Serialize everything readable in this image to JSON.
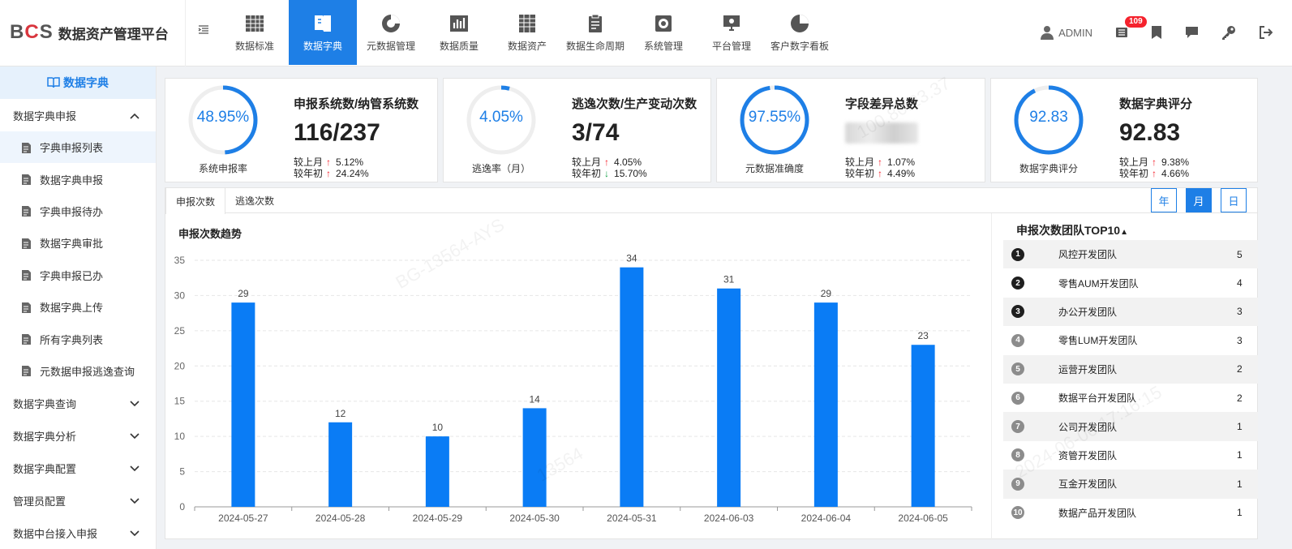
{
  "app": {
    "logo_b": "B",
    "logo_c": "C",
    "logo_s": "S",
    "name": "数据资产管理平台"
  },
  "nav": [
    {
      "label": "数据标准",
      "icon": "table-grid-icon",
      "active": false
    },
    {
      "label": "数据字典",
      "icon": "book-icon",
      "active": true
    },
    {
      "label": "元数据管理",
      "icon": "pie-chart-icon",
      "active": false
    },
    {
      "label": "数据质量",
      "icon": "bar-chart-icon",
      "active": false
    },
    {
      "label": "数据资产",
      "icon": "spreadsheet-icon",
      "active": false
    },
    {
      "label": "数据生命周期",
      "icon": "clipboard-icon",
      "active": false
    },
    {
      "label": "系统管理",
      "icon": "gear-icon",
      "active": false
    },
    {
      "label": "平台管理",
      "icon": "monitor-icon",
      "active": false
    },
    {
      "label": "客户数字看板",
      "icon": "dashboard-pie-icon",
      "active": false
    }
  ],
  "user": {
    "name": "ADMIN",
    "notification_count": "109"
  },
  "sidebar": {
    "title": "数据字典",
    "groups": [
      {
        "label": "数据字典申报",
        "expanded": true,
        "items": [
          {
            "label": "字典申报列表",
            "active": true
          },
          {
            "label": "数据字典申报",
            "active": false
          },
          {
            "label": "字典申报待办",
            "active": false
          },
          {
            "label": "数据字典审批",
            "active": false
          },
          {
            "label": "字典申报已办",
            "active": false
          },
          {
            "label": "数据字典上传",
            "active": false
          },
          {
            "label": "所有字典列表",
            "active": false
          },
          {
            "label": "元数据申报逃逸查询",
            "active": false
          }
        ]
      },
      {
        "label": "数据字典查询",
        "expanded": false
      },
      {
        "label": "数据字典分析",
        "expanded": false
      },
      {
        "label": "数据字典配置",
        "expanded": false
      },
      {
        "label": "管理员配置",
        "expanded": false
      },
      {
        "label": "数据中台接入申报",
        "expanded": false
      }
    ]
  },
  "cards": [
    {
      "ring_value": "48.95%",
      "ring_fraction": 0.4895,
      "ring_label": "系统申报率",
      "title": "申报系统数/纳管系统数",
      "big": "116/237",
      "cmp1_label": "较上月",
      "cmp1_dir": "up",
      "cmp1_value": "5.12%",
      "cmp2_label": "较年初",
      "cmp2_dir": "up",
      "cmp2_value": "24.24%"
    },
    {
      "ring_value": "4.05%",
      "ring_fraction": 0.0405,
      "ring_label": "逃逸率（月）",
      "title": "逃逸次数/生产变动次数",
      "big": "3/74",
      "cmp1_label": "较上月",
      "cmp1_dir": "up",
      "cmp1_value": "4.05%",
      "cmp2_label": "较年初",
      "cmp2_dir": "down",
      "cmp2_value": "15.70%"
    },
    {
      "ring_value": "97.55%",
      "ring_fraction": 0.9755,
      "ring_label": "元数据准确度",
      "title": "字段差异总数",
      "big": "",
      "cmp1_label": "较上月",
      "cmp1_dir": "up",
      "cmp1_value": "1.07%",
      "cmp2_label": "较年初",
      "cmp2_dir": "up",
      "cmp2_value": "4.49%"
    },
    {
      "ring_value": "92.83",
      "ring_fraction": 0.9283,
      "ring_label": "数据字典评分",
      "title": "数据字典评分",
      "big": "92.83",
      "cmp1_label": "较上月",
      "cmp1_dir": "up",
      "cmp1_value": "9.38%",
      "cmp2_label": "较年初",
      "cmp2_dir": "up",
      "cmp2_value": "4.66%"
    }
  ],
  "tabs": [
    {
      "label": "申报次数",
      "active": true
    },
    {
      "label": "逃逸次数",
      "active": false
    }
  ],
  "periods": [
    {
      "label": "年",
      "active": false
    },
    {
      "label": "月",
      "active": true
    },
    {
      "label": "日",
      "active": false
    }
  ],
  "chart_title": "申报次数趋势",
  "chart_data": {
    "type": "bar",
    "categories": [
      "2024-05-27",
      "2024-05-28",
      "2024-05-29",
      "2024-05-30",
      "2024-05-31",
      "2024-06-03",
      "2024-06-04",
      "2024-06-05"
    ],
    "values": [
      29,
      12,
      10,
      14,
      34,
      31,
      29,
      23
    ],
    "title": "申报次数趋势",
    "ylim": [
      0,
      35
    ],
    "yticks": [
      0,
      5,
      10,
      15,
      20,
      25,
      30,
      35
    ],
    "grid": true,
    "data_labels": true,
    "color": "#0a7cf5"
  },
  "ranking": {
    "title": "申报次数团队TOP10",
    "sort_icon": "sort-icon",
    "rows": [
      {
        "rank": "1",
        "name": "风控开发团队",
        "count": "5"
      },
      {
        "rank": "2",
        "name": "零售AUM开发团队",
        "count": "4"
      },
      {
        "rank": "3",
        "name": "办公开发团队",
        "count": "3"
      },
      {
        "rank": "4",
        "name": "零售LUM开发团队",
        "count": "3"
      },
      {
        "rank": "5",
        "name": "运营开发团队",
        "count": "2"
      },
      {
        "rank": "6",
        "name": "数据平台开发团队",
        "count": "2"
      },
      {
        "rank": "7",
        "name": "公司开发团队",
        "count": "1"
      },
      {
        "rank": "8",
        "name": "资管开发团队",
        "count": "1"
      },
      {
        "rank": "9",
        "name": "互金开发团队",
        "count": "1"
      },
      {
        "rank": "10",
        "name": "数据产品开发团队",
        "count": "1"
      }
    ]
  },
  "watermark": {
    "id": "13564",
    "code": "BG-13564-AYS",
    "ip": "100.80.23.37",
    "time": "2024-06-06 17:16:15"
  },
  "colors": {
    "accent": "#1e7fe6",
    "up": "#f5222d",
    "down": "#16a34a",
    "ring_track": "#eeeeee"
  }
}
